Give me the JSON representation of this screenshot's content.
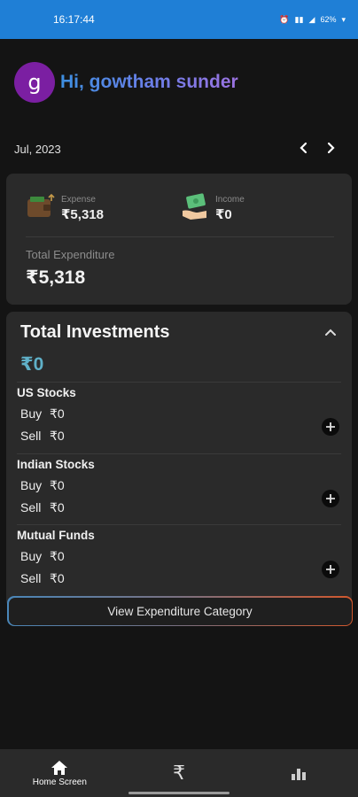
{
  "status": {
    "time": "16:17:44",
    "battery": "62%"
  },
  "user": {
    "avatar_letter": "g",
    "greeting": "Hi, gowtham sunder"
  },
  "month": {
    "label": "Jul, 2023",
    "prev_icon": "chevron-left-icon",
    "next_icon": "chevron-right-icon"
  },
  "summary": {
    "expense_label": "Expense",
    "expense_value": "₹5,318",
    "income_label": "Income",
    "income_value": "₹0",
    "total_label": "Total Expenditure",
    "total_value": "₹5,318"
  },
  "investments": {
    "title": "Total Investments",
    "total": "₹0",
    "sections": [
      {
        "name": "US Stocks",
        "buy_label": "Buy",
        "buy": "₹0",
        "sell_label": "Sell",
        "sell": "₹0"
      },
      {
        "name": "Indian Stocks",
        "buy_label": "Buy",
        "buy": "₹0",
        "sell_label": "Sell",
        "sell": "₹0"
      },
      {
        "name": "Mutual Funds",
        "buy_label": "Buy",
        "buy": "₹0",
        "sell_label": "Sell",
        "sell": "₹0"
      }
    ]
  },
  "view_button": "View Expenditure Category",
  "bottom_nav": {
    "home_label": "Home Screen",
    "rupee_symbol": "₹"
  },
  "colors": {
    "status_bar": "#1f7fd6",
    "avatar": "#7b1fa2",
    "invest_total": "#5fb0c8",
    "background": "#141414",
    "card": "#2a2a2a"
  }
}
